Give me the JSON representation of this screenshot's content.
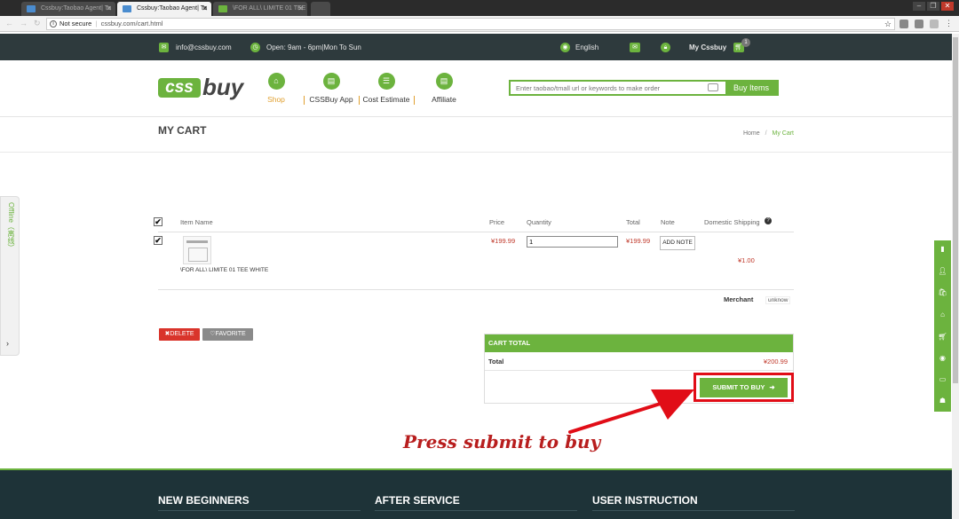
{
  "browser": {
    "tabs": [
      {
        "title": "Cssbuy:Taobao Agent| Ta",
        "active": false
      },
      {
        "title": "Cssbuy:Taobao Agent| Ta",
        "active": true
      },
      {
        "title": "\\FOR ALL\\ LIMITE 01 TEE",
        "active": false
      }
    ],
    "security_label": "Not secure",
    "url": "cssbuy.com/cart.html"
  },
  "topbar": {
    "email": "info@cssbuy.com",
    "hours": "Open: 9am - 6pm|Mon To Sun",
    "language": "English",
    "account": "My Cssbuy",
    "cart_count": "1"
  },
  "header": {
    "logo_text_1": "css",
    "logo_text_2": "buy",
    "nav": [
      "Shop",
      "CSSBuy App",
      "Cost Estimate",
      "Affiliate"
    ],
    "search_placeholder": "Enter taobao/tmall url or keywords to make order",
    "search_button": "Buy Items"
  },
  "page": {
    "title": "MY CART",
    "breadcrumb": {
      "home": "Home",
      "sep": "/",
      "current": "My Cart"
    }
  },
  "cart": {
    "columns": [
      "Item Name",
      "Price",
      "Quantity",
      "Total",
      "Note",
      "Domestic Shipping"
    ],
    "item": {
      "name": "\\FOR ALL\\ LIMITE 01 TEE WHITE",
      "price": "¥199.99",
      "quantity": "1",
      "total": "¥199.99",
      "note_button": "ADD NOTE",
      "shipping": "¥1.00"
    },
    "merchant_label": "Merchant",
    "merchant_value": "unknow",
    "delete_button": "DELETE",
    "favorite_button": "FAVORITE"
  },
  "total": {
    "header": "CART TOTAL",
    "label": "Total",
    "value": "¥200.99",
    "submit_button": "SUBMIT TO BUY"
  },
  "annotation": "Press submit to buy",
  "side": {
    "offline_label": "Offline（离线）"
  },
  "footer": {
    "columns": [
      "NEW BEGINNERS",
      "AFTER SERVICE",
      "USER INSTRUCTION"
    ]
  },
  "colors": {
    "brand_green": "#6cb33e",
    "dark_bar": "#2e3a3d",
    "price_red": "#c0392b",
    "annotation_red": "#e10d17"
  }
}
